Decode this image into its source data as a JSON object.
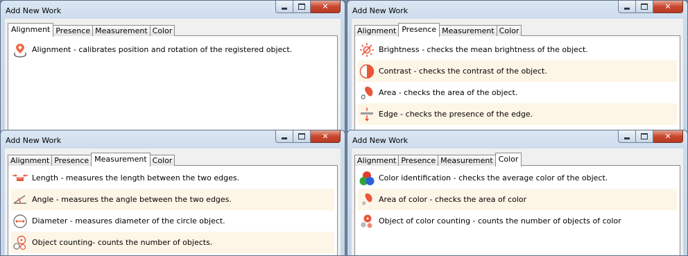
{
  "windows": [
    {
      "title": "Add New Work",
      "tabs": [
        "Alignment",
        "Presence",
        "Measurement",
        "Color"
      ],
      "active_tab": "Alignment",
      "items": [
        {
          "icon": "alignment-icon",
          "text": "Alignment - calibrates position and rotation of the registered object."
        }
      ]
    },
    {
      "title": "Add New Work",
      "tabs": [
        "Alignment",
        "Presence",
        "Measurement",
        "Color"
      ],
      "active_tab": "Presence",
      "items": [
        {
          "icon": "brightness-icon",
          "text": "Brightness - checks the mean brightness of the object."
        },
        {
          "icon": "contrast-icon",
          "text": "Contrast - checks the contrast of the object."
        },
        {
          "icon": "area-icon",
          "text": "Area - checks the area of the object."
        },
        {
          "icon": "edge-icon",
          "text": "Edge - checks the presence of the edge."
        }
      ]
    },
    {
      "title": "Add New Work",
      "tabs": [
        "Alignment",
        "Presence",
        "Measurement",
        "Color"
      ],
      "active_tab": "Measurement",
      "items": [
        {
          "icon": "length-icon",
          "text": "Length - measures the length between the two edges."
        },
        {
          "icon": "angle-icon",
          "text": "Angle - measures the angle between the two edges."
        },
        {
          "icon": "diameter-icon",
          "text": "Diameter - measures diameter of the circle object."
        },
        {
          "icon": "object-counting-icon",
          "text": "Object counting- counts the number of objects."
        }
      ]
    },
    {
      "title": "Add New Work",
      "tabs": [
        "Alignment",
        "Presence",
        "Measurement",
        "Color"
      ],
      "active_tab": "Color",
      "items": [
        {
          "icon": "color-identification-icon",
          "text": "Color identification - checks the average color of the object."
        },
        {
          "icon": "area-of-color-icon",
          "text": "Area of color - checks the area of color"
        },
        {
          "icon": "color-counting-icon",
          "text": "Object of color counting - counts the number of objects of color"
        }
      ]
    }
  ],
  "colors": {
    "accent": "#e8563a",
    "row_alt": "#fdf5e6",
    "close_button": "#c8472d"
  }
}
